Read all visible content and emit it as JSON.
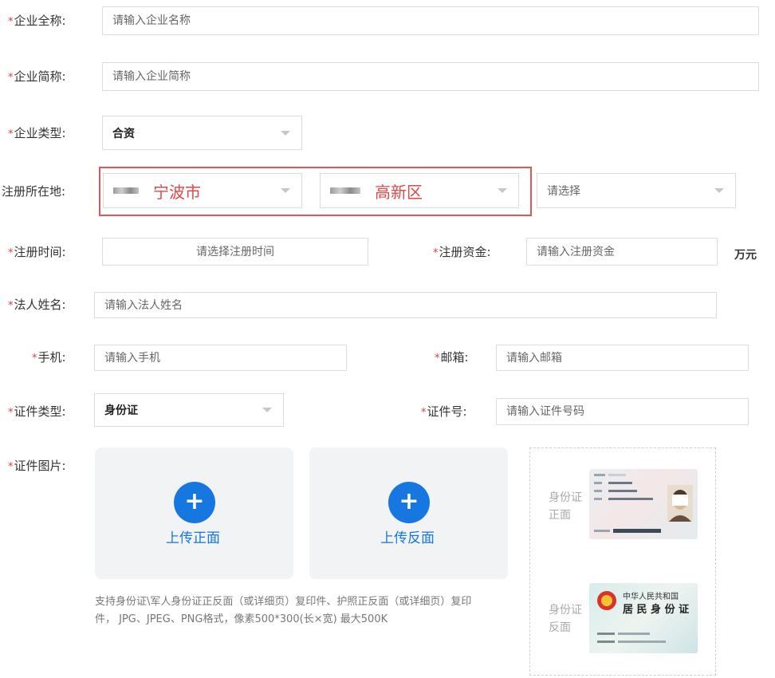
{
  "form": {
    "company_name": {
      "label": "企业全称:",
      "placeholder": "请输入企业名称"
    },
    "company_short": {
      "label": "企业简称:",
      "placeholder": "请输入企业简称"
    },
    "company_type": {
      "label": "企业类型:",
      "value": "合资"
    },
    "location": {
      "label": "注册所在地:",
      "city": "宁波市",
      "district": "高新区",
      "third_placeholder": "请选择"
    },
    "reg_time": {
      "label": "注册时间:",
      "placeholder": "请选择注册时间"
    },
    "reg_capital": {
      "label": "注册资金:",
      "placeholder": "请输入注册资金",
      "unit": "万元"
    },
    "legal_name": {
      "label": "法人姓名:",
      "placeholder": "请输入法人姓名"
    },
    "phone": {
      "label": "手机:",
      "placeholder": "请输入手机"
    },
    "email": {
      "label": "邮箱:",
      "placeholder": "请输入邮箱"
    },
    "cert_type": {
      "label": "证件类型:",
      "value": "身份证"
    },
    "cert_no": {
      "label": "证件号:",
      "placeholder": "请输入证件号码"
    },
    "cert_image": {
      "label": "证件图片:",
      "upload_front": "上传正面",
      "upload_back": "上传反面",
      "plus": "+",
      "hint_line1": "支持身份证\\军人身份证正反面（或详细页）复印件、护照正反面（或详细页）复印",
      "hint_line2": "件， JPG、JPEG、PNG格式，像素500*300(长×宽) 最大500K",
      "sample_front_label_1": "身份证",
      "sample_front_label_2": "正面",
      "sample_back_label_1": "身份证",
      "sample_back_label_2": "反面",
      "back_card_line1": "中华人民共和国",
      "back_card_line2": "居 民 身 份 证"
    }
  },
  "required_mark": "*",
  "colors": {
    "accent": "#1677e0",
    "required": "#e23c3c",
    "highlight": "#e45555"
  }
}
